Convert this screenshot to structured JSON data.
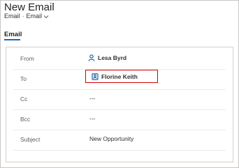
{
  "header": {
    "title": "New Email",
    "entity": "Email",
    "separator": "·",
    "form": "Email"
  },
  "tabs": [
    {
      "label": "Email",
      "active": true
    }
  ],
  "fields": {
    "from": {
      "label": "From",
      "value": "Lesa Byrd",
      "icon": "person-icon"
    },
    "to": {
      "label": "To",
      "value": "Florine Keith",
      "icon": "contact-card-icon",
      "highlighted": true
    },
    "cc": {
      "label": "Cc",
      "value": "---"
    },
    "bcc": {
      "label": "Bcc",
      "value": "---"
    },
    "subject": {
      "label": "Subject",
      "value": "New Opportunity"
    }
  },
  "colors": {
    "accent": "#0f6cbd",
    "lookup_text": "#0f54a8",
    "highlight_border": "#d40000"
  }
}
